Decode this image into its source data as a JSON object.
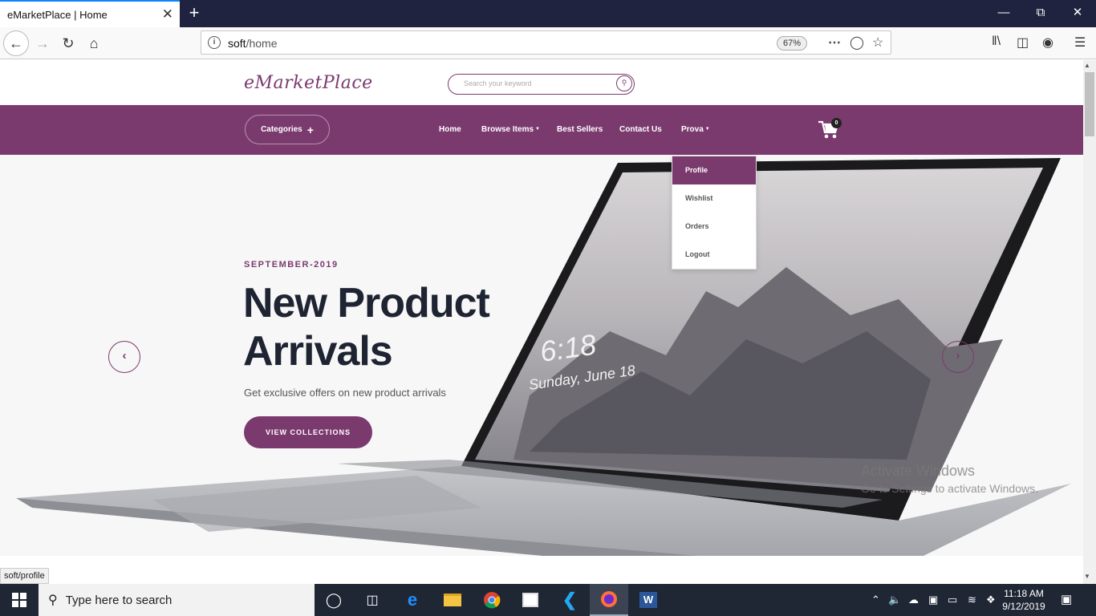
{
  "browser": {
    "tab_title": "eMarketPlace | Home",
    "tab_close": "✕",
    "new_tab": "+",
    "url_host": "soft",
    "url_path": "/home",
    "zoom": "67%",
    "status_link": "soft/profile"
  },
  "site": {
    "logo": "eMarketPlace",
    "search_placeholder": "Search your keyword",
    "categories_label": "Categories",
    "nav": [
      "Home",
      "Browse Items",
      "Best Sellers",
      "Contact Us",
      "Prova"
    ],
    "cart_count": "0",
    "dropdown": [
      "Profile",
      "Wishlist",
      "Orders",
      "Logout"
    ],
    "hero": {
      "kicker": "SEPTEMBER-2019",
      "headline_line1": "New Product",
      "headline_line2": "Arrivals",
      "subline": "Get exclusive offers on new product arrivals",
      "cta": "VIEW COLLECTIONS",
      "screen_time": "6:18",
      "screen_date": "Sunday, June 18"
    },
    "brand_color": "#7b3a6e"
  },
  "watermark": {
    "title": "Activate Windows",
    "subtitle": "Go to Settings to activate Windows."
  },
  "taskbar": {
    "search_placeholder": "Type here to search",
    "time": "11:18 AM",
    "date": "9/12/2019"
  }
}
